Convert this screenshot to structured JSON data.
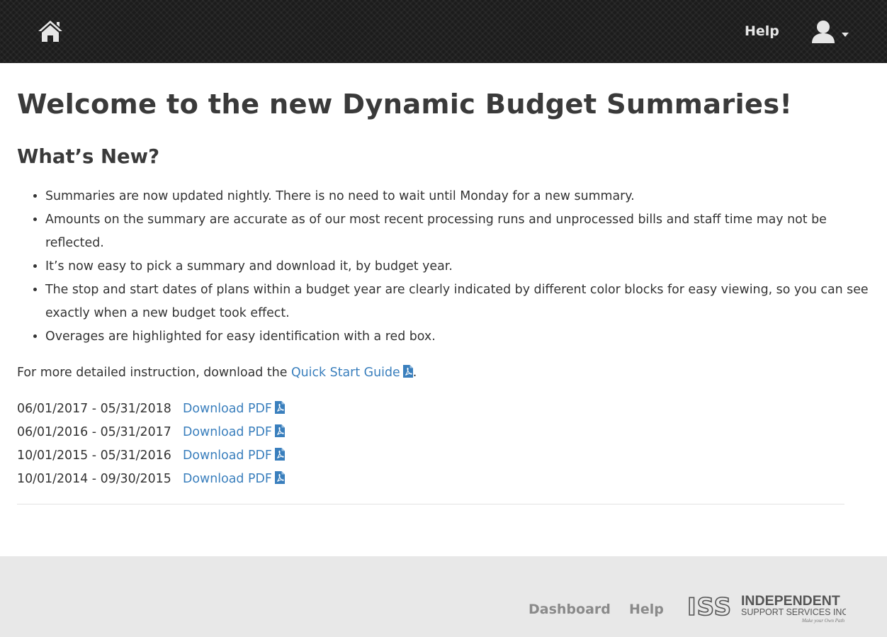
{
  "header": {
    "home_icon": "home-icon",
    "help_label": "Help",
    "user_icon": "user-icon",
    "caret_icon": "caret-down-icon"
  },
  "main": {
    "title": "Welcome to the new Dynamic Budget Summaries!",
    "subtitle": "What’s New?",
    "bullets": [
      "Summaries are now updated nightly. There is no need to wait until Monday for a new summary.",
      "Amounts on the summary are accurate as of our most recent processing runs and unprocessed bills and staff time may not be reflected.",
      "It’s now easy to pick a summary and download it, by budget year.",
      "The stop and start dates of plans within a budget year are clearly indicated by different color blocks for easy viewing, so you can see exactly when a new budget took effect.",
      "Overages are highlighted for easy identification with a red box."
    ],
    "instruction_prefix": "For more detailed instruction, download the",
    "guide_link": "Quick Start Guide",
    "instruction_suffix": ".",
    "summaries": [
      {
        "range": "06/01/2017 - 05/31/2018",
        "link": "Download PDF"
      },
      {
        "range": "06/01/2016 - 05/31/2017",
        "link": "Download PDF"
      },
      {
        "range": "10/01/2015 - 05/31/2016",
        "link": "Download PDF"
      },
      {
        "range": "10/01/2014 - 09/30/2015",
        "link": "Download PDF"
      }
    ]
  },
  "footer": {
    "dashboard_label": "Dashboard",
    "help_label": "Help",
    "logo": {
      "mark": "ISS",
      "line1": "INDEPENDENT",
      "line2": "SUPPORT SERVICES INC.",
      "tagline": "Make your Own Path"
    }
  },
  "colors": {
    "link": "#3a7fbd",
    "header_bg": "#1c1c1c",
    "footer_bg": "#e8e8e8",
    "text": "#333333"
  }
}
